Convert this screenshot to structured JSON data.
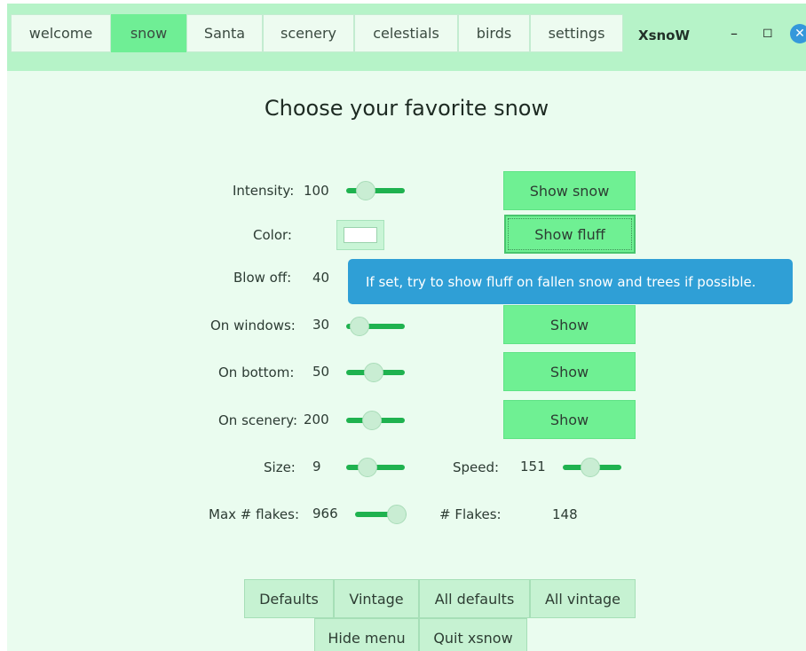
{
  "tabs": [
    {
      "label": "welcome"
    },
    {
      "label": "snow"
    },
    {
      "label": "Santa"
    },
    {
      "label": "scenery"
    },
    {
      "label": "celestials"
    },
    {
      "label": "birds"
    },
    {
      "label": "settings"
    }
  ],
  "app_title": "XsnoW",
  "window_controls": {
    "minimize": "–",
    "maximize": "◻",
    "close": "✕"
  },
  "page_title": "Choose your favorite snow",
  "settings": {
    "intensity": {
      "label": "Intensity:",
      "value": "100",
      "fraction": 0.25
    },
    "color": {
      "label": "Color:",
      "value": "#ffffff"
    },
    "blow_off": {
      "label": "Blow off:",
      "value": "40"
    },
    "on_windows": {
      "label": "On windows:",
      "value": "30",
      "fraction": 0.1
    },
    "on_bottom": {
      "label": "On bottom:",
      "value": "50",
      "fraction": 0.45
    },
    "on_scenery": {
      "label": "On scenery:",
      "value": "200",
      "fraction": 0.4
    },
    "size": {
      "label": "Size:",
      "value": "9",
      "fraction": 0.3
    },
    "speed": {
      "label": "Speed:",
      "value": "151",
      "fraction": 0.45
    },
    "max_flakes": {
      "label": "Max # flakes:",
      "value": "966",
      "fraction": 1.0
    },
    "flakes": {
      "label": "# Flakes:",
      "value": "148"
    }
  },
  "buttons": {
    "show_snow": "Show snow",
    "show_fluff": "Show fluff",
    "show_windows": "Show",
    "show_bottom": "Show",
    "show_scenery": "Show"
  },
  "tooltip": "If set, try to show fluff on fallen snow and trees if possible.",
  "bottom_buttons": {
    "defaults": "Defaults",
    "vintage": "Vintage",
    "all_defaults": "All defaults",
    "all_vintage": "All vintage",
    "hide_menu": "Hide menu",
    "quit": "Quit xsnow"
  },
  "colors": {
    "accent": "#6ff093",
    "slider_track": "#1fb24f",
    "tooltip_bg": "#2f9fd6",
    "background": "#eafcef"
  }
}
